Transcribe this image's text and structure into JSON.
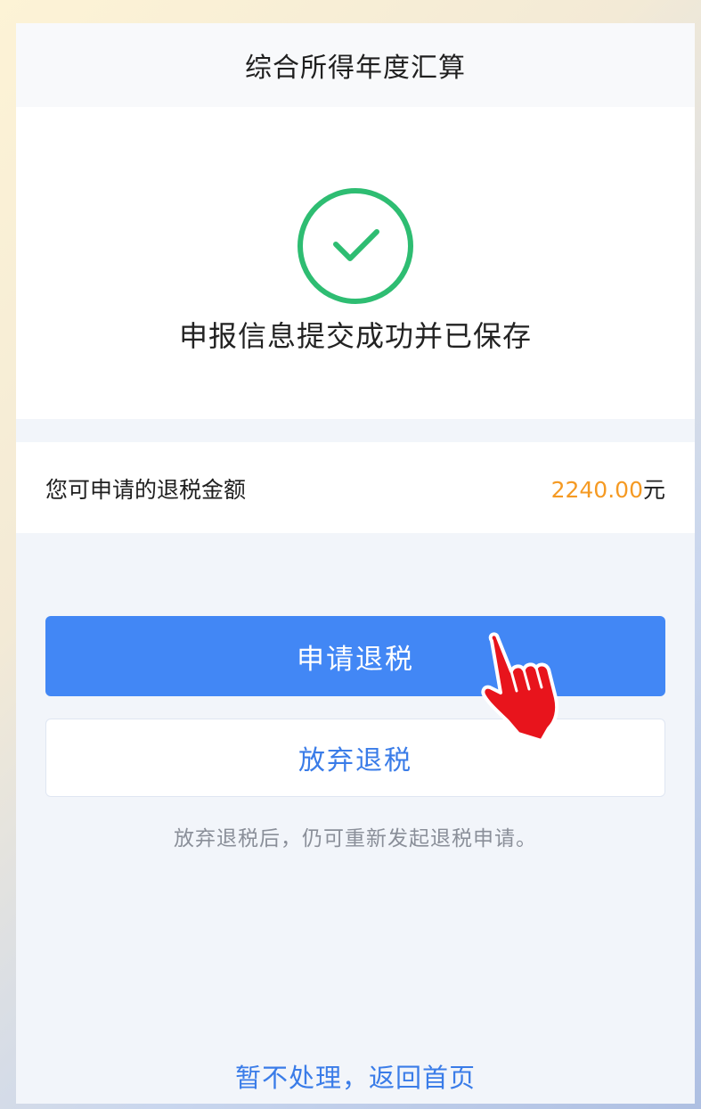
{
  "header": {
    "title": "综合所得年度汇算"
  },
  "status": {
    "icon": "check-circle-icon",
    "message": "申报信息提交成功并已保存"
  },
  "refund": {
    "label": "您可申请的退税金额",
    "amount": "2240.00",
    "unit": "元"
  },
  "actions": {
    "apply_label": "申请退税",
    "giveup_label": "放弃退税",
    "hint": "放弃退税后，仍可重新发起退税申请。",
    "back_home_label": "暂不处理，返回首页"
  },
  "colors": {
    "primary": "#4287f5",
    "success": "#2ebd72",
    "amount": "#f59a23",
    "pointer": "#e8141c"
  }
}
